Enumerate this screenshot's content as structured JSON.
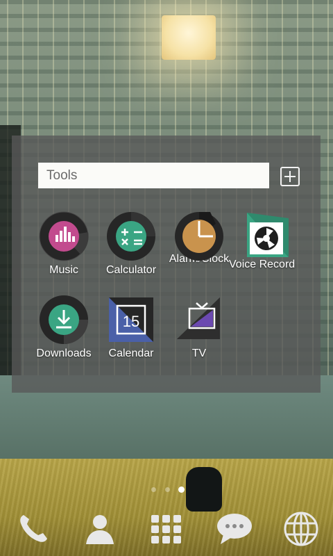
{
  "folder": {
    "title": "Tools",
    "add_button_label": "+"
  },
  "apps": [
    {
      "label": "Music",
      "icon": "music-icon",
      "color": "#c24b8e"
    },
    {
      "label": "Calculator",
      "icon": "calculator-icon",
      "color": "#3aa583"
    },
    {
      "label": "Alarm/Clock",
      "icon": "clock-icon",
      "color": "#c9934d"
    },
    {
      "label": "Voice Record",
      "icon": "voice-recorder-icon",
      "color": "#3aa583"
    },
    {
      "label": "Downloads",
      "icon": "download-icon",
      "color": "#3aa583"
    },
    {
      "label": "Calendar",
      "icon": "calendar-icon",
      "color": "#4a60a8"
    },
    {
      "label": "TV",
      "icon": "tv-icon",
      "color": "#6b49b0"
    }
  ],
  "calendar_day": "15",
  "pager": {
    "pages": 3,
    "current": 3
  },
  "dock": [
    {
      "name": "phone-icon"
    },
    {
      "name": "contacts-icon"
    },
    {
      "name": "apps-grid-icon"
    },
    {
      "name": "messages-icon"
    },
    {
      "name": "browser-icon"
    }
  ]
}
